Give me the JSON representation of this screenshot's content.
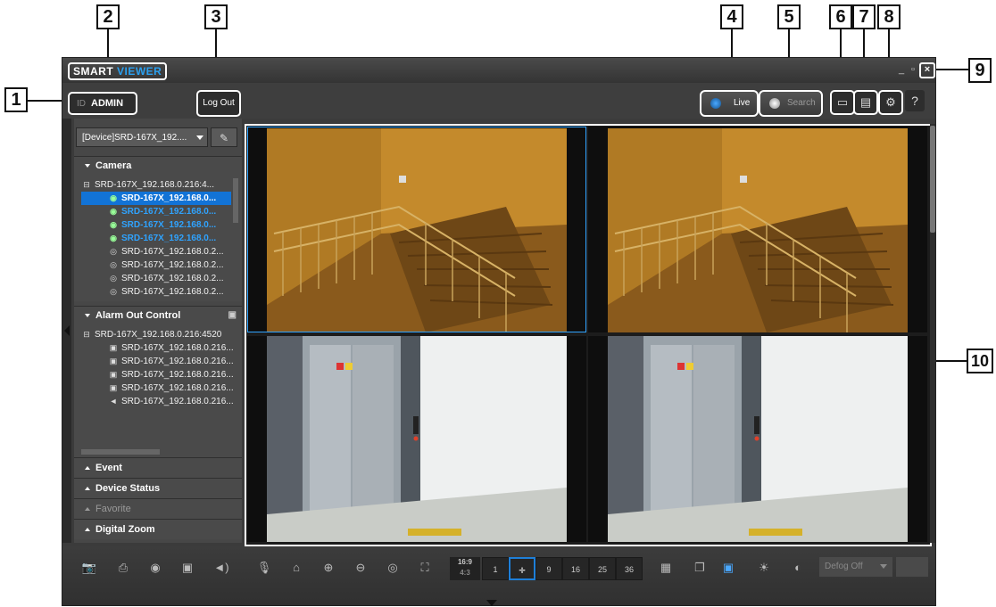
{
  "callouts": {
    "c1": "1",
    "c2": "2",
    "c3": "3",
    "c4": "4",
    "c5": "5",
    "c6": "6",
    "c7": "7",
    "c8": "8",
    "c9": "9",
    "c10": "10"
  },
  "titlebar": {
    "brand_part1": "SMART ",
    "brand_part2": "VIEWER",
    "brand_accent_color": "#2aa0f0"
  },
  "topbar": {
    "id_label": "ID",
    "user": "ADMIN",
    "logout": "Log Out",
    "live": "Live",
    "search": "Search",
    "help": "?"
  },
  "sidebar": {
    "device_select": "[Device]SRD-167X_192....",
    "camera_panel": {
      "title": "Camera",
      "rows": [
        "SRD-167X_192.168.0.216:4...",
        "SRD-167X_192.168.0...",
        "SRD-167X_192.168.0...",
        "SRD-167X_192.168.0...",
        "SRD-167X_192.168.0...",
        "SRD-167X_192.168.0.2...",
        "SRD-167X_192.168.0.2...",
        "SRD-167X_192.168.0.2...",
        "SRD-167X_192.168.0.2..."
      ]
    },
    "alarm_panel": {
      "title": "Alarm Out Control",
      "rows": [
        "SRD-167X_192.168.0.216:4520",
        "SRD-167X_192.168.0.216...",
        "SRD-167X_192.168.0.216...",
        "SRD-167X_192.168.0.216...",
        "SRD-167X_192.168.0.216...",
        "SRD-167X_192.168.0.216..."
      ]
    },
    "collapsed_panels": [
      "Event",
      "Device Status",
      "Favorite",
      "Digital Zoom"
    ]
  },
  "bottombar": {
    "ratio_top": "16:9",
    "ratio_bottom": "4:3",
    "layouts": [
      "1",
      "4",
      "9",
      "16",
      "25",
      "36"
    ],
    "active_layout": "4",
    "defog": "Defog Off"
  },
  "colors": {
    "selection": "#1273d6",
    "active_text": "#2fa3ff"
  }
}
